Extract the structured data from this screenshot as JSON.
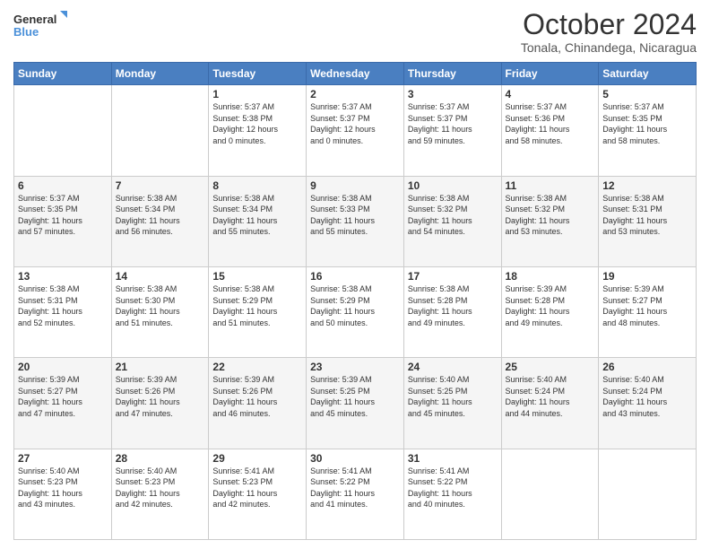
{
  "logo": {
    "line1": "General",
    "line2": "Blue"
  },
  "title": "October 2024",
  "location": "Tonala, Chinandega, Nicaragua",
  "weekdays": [
    "Sunday",
    "Monday",
    "Tuesday",
    "Wednesday",
    "Thursday",
    "Friday",
    "Saturday"
  ],
  "weeks": [
    [
      {
        "day": "",
        "info": ""
      },
      {
        "day": "",
        "info": ""
      },
      {
        "day": "1",
        "info": "Sunrise: 5:37 AM\nSunset: 5:38 PM\nDaylight: 12 hours\nand 0 minutes."
      },
      {
        "day": "2",
        "info": "Sunrise: 5:37 AM\nSunset: 5:37 PM\nDaylight: 12 hours\nand 0 minutes."
      },
      {
        "day": "3",
        "info": "Sunrise: 5:37 AM\nSunset: 5:37 PM\nDaylight: 11 hours\nand 59 minutes."
      },
      {
        "day": "4",
        "info": "Sunrise: 5:37 AM\nSunset: 5:36 PM\nDaylight: 11 hours\nand 58 minutes."
      },
      {
        "day": "5",
        "info": "Sunrise: 5:37 AM\nSunset: 5:35 PM\nDaylight: 11 hours\nand 58 minutes."
      }
    ],
    [
      {
        "day": "6",
        "info": "Sunrise: 5:37 AM\nSunset: 5:35 PM\nDaylight: 11 hours\nand 57 minutes."
      },
      {
        "day": "7",
        "info": "Sunrise: 5:38 AM\nSunset: 5:34 PM\nDaylight: 11 hours\nand 56 minutes."
      },
      {
        "day": "8",
        "info": "Sunrise: 5:38 AM\nSunset: 5:34 PM\nDaylight: 11 hours\nand 55 minutes."
      },
      {
        "day": "9",
        "info": "Sunrise: 5:38 AM\nSunset: 5:33 PM\nDaylight: 11 hours\nand 55 minutes."
      },
      {
        "day": "10",
        "info": "Sunrise: 5:38 AM\nSunset: 5:32 PM\nDaylight: 11 hours\nand 54 minutes."
      },
      {
        "day": "11",
        "info": "Sunrise: 5:38 AM\nSunset: 5:32 PM\nDaylight: 11 hours\nand 53 minutes."
      },
      {
        "day": "12",
        "info": "Sunrise: 5:38 AM\nSunset: 5:31 PM\nDaylight: 11 hours\nand 53 minutes."
      }
    ],
    [
      {
        "day": "13",
        "info": "Sunrise: 5:38 AM\nSunset: 5:31 PM\nDaylight: 11 hours\nand 52 minutes."
      },
      {
        "day": "14",
        "info": "Sunrise: 5:38 AM\nSunset: 5:30 PM\nDaylight: 11 hours\nand 51 minutes."
      },
      {
        "day": "15",
        "info": "Sunrise: 5:38 AM\nSunset: 5:29 PM\nDaylight: 11 hours\nand 51 minutes."
      },
      {
        "day": "16",
        "info": "Sunrise: 5:38 AM\nSunset: 5:29 PM\nDaylight: 11 hours\nand 50 minutes."
      },
      {
        "day": "17",
        "info": "Sunrise: 5:38 AM\nSunset: 5:28 PM\nDaylight: 11 hours\nand 49 minutes."
      },
      {
        "day": "18",
        "info": "Sunrise: 5:39 AM\nSunset: 5:28 PM\nDaylight: 11 hours\nand 49 minutes."
      },
      {
        "day": "19",
        "info": "Sunrise: 5:39 AM\nSunset: 5:27 PM\nDaylight: 11 hours\nand 48 minutes."
      }
    ],
    [
      {
        "day": "20",
        "info": "Sunrise: 5:39 AM\nSunset: 5:27 PM\nDaylight: 11 hours\nand 47 minutes."
      },
      {
        "day": "21",
        "info": "Sunrise: 5:39 AM\nSunset: 5:26 PM\nDaylight: 11 hours\nand 47 minutes."
      },
      {
        "day": "22",
        "info": "Sunrise: 5:39 AM\nSunset: 5:26 PM\nDaylight: 11 hours\nand 46 minutes."
      },
      {
        "day": "23",
        "info": "Sunrise: 5:39 AM\nSunset: 5:25 PM\nDaylight: 11 hours\nand 45 minutes."
      },
      {
        "day": "24",
        "info": "Sunrise: 5:40 AM\nSunset: 5:25 PM\nDaylight: 11 hours\nand 45 minutes."
      },
      {
        "day": "25",
        "info": "Sunrise: 5:40 AM\nSunset: 5:24 PM\nDaylight: 11 hours\nand 44 minutes."
      },
      {
        "day": "26",
        "info": "Sunrise: 5:40 AM\nSunset: 5:24 PM\nDaylight: 11 hours\nand 43 minutes."
      }
    ],
    [
      {
        "day": "27",
        "info": "Sunrise: 5:40 AM\nSunset: 5:23 PM\nDaylight: 11 hours\nand 43 minutes."
      },
      {
        "day": "28",
        "info": "Sunrise: 5:40 AM\nSunset: 5:23 PM\nDaylight: 11 hours\nand 42 minutes."
      },
      {
        "day": "29",
        "info": "Sunrise: 5:41 AM\nSunset: 5:23 PM\nDaylight: 11 hours\nand 42 minutes."
      },
      {
        "day": "30",
        "info": "Sunrise: 5:41 AM\nSunset: 5:22 PM\nDaylight: 11 hours\nand 41 minutes."
      },
      {
        "day": "31",
        "info": "Sunrise: 5:41 AM\nSunset: 5:22 PM\nDaylight: 11 hours\nand 40 minutes."
      },
      {
        "day": "",
        "info": ""
      },
      {
        "day": "",
        "info": ""
      }
    ]
  ]
}
